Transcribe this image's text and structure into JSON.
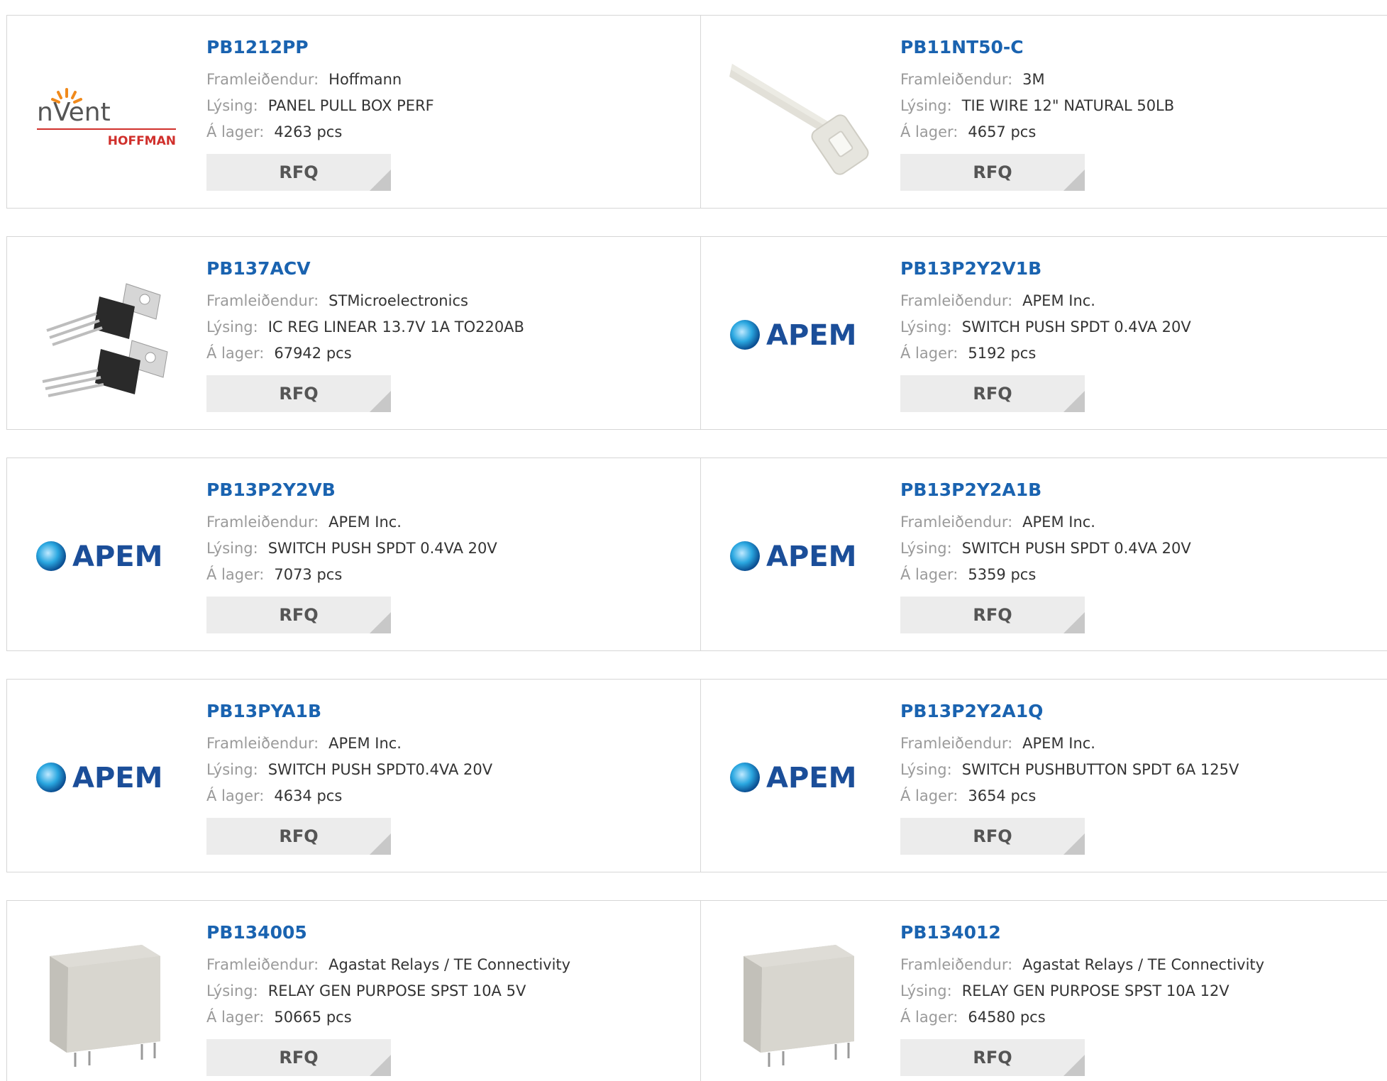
{
  "labels": {
    "manufacturer": "Framleiðendur:",
    "description": "Lýsing:",
    "stock": "Á lager:",
    "rfq": "RFQ"
  },
  "colors": {
    "title": "#1a63b0",
    "label": "#9a9a9a",
    "value": "#333333",
    "rfq_bg": "#ececec",
    "border": "#d6d6d6"
  },
  "products": [
    {
      "part": "PB1212PP",
      "manufacturer": "Hoffmann",
      "description": "PANEL PULL BOX PERF",
      "stock": "4263 pcs",
      "image": "nvent-hoffman-logo",
      "logo_text": [
        "nVent",
        "HOFFMAN"
      ]
    },
    {
      "part": "PB11NT50-C",
      "manufacturer": "3M",
      "description": "TIE WIRE 12\" NATURAL 50LB",
      "stock": "4657 pcs",
      "image": "cable-tie-photo"
    },
    {
      "part": "PB137ACV",
      "manufacturer": "STMicroelectronics",
      "description": "IC REG LINEAR 13.7V 1A TO220AB",
      "stock": "67942 pcs",
      "image": "to220-regulator-photo"
    },
    {
      "part": "PB13P2Y2V1B",
      "manufacturer": "APEM Inc.",
      "description": "SWITCH PUSH SPDT 0.4VA 20V",
      "stock": "5192 pcs",
      "image": "apem-logo",
      "logo_text": [
        "APEM"
      ]
    },
    {
      "part": "PB13P2Y2VB",
      "manufacturer": "APEM Inc.",
      "description": "SWITCH PUSH SPDT 0.4VA 20V",
      "stock": "7073 pcs",
      "image": "apem-logo",
      "logo_text": [
        "APEM"
      ]
    },
    {
      "part": "PB13P2Y2A1B",
      "manufacturer": "APEM Inc.",
      "description": "SWITCH PUSH SPDT 0.4VA 20V",
      "stock": "5359 pcs",
      "image": "apem-logo",
      "logo_text": [
        "APEM"
      ]
    },
    {
      "part": "PB13PYA1B",
      "manufacturer": "APEM Inc.",
      "description": "SWITCH PUSH SPDT0.4VA 20V",
      "stock": "4634 pcs",
      "image": "apem-logo",
      "logo_text": [
        "APEM"
      ]
    },
    {
      "part": "PB13P2Y2A1Q",
      "manufacturer": "APEM Inc.",
      "description": "SWITCH PUSHBUTTON SPDT 6A 125V",
      "stock": "3654 pcs",
      "image": "apem-logo",
      "logo_text": [
        "APEM"
      ]
    },
    {
      "part": "PB134005",
      "manufacturer": "Agastat Relays / TE Connectivity",
      "description": "RELAY GEN PURPOSE SPST 10A 5V",
      "stock": "50665 pcs",
      "image": "relay-photo"
    },
    {
      "part": "PB134012",
      "manufacturer": "Agastat Relays / TE Connectivity",
      "description": "RELAY GEN PURPOSE SPST 10A 12V",
      "stock": "64580 pcs",
      "image": "relay-photo"
    }
  ]
}
